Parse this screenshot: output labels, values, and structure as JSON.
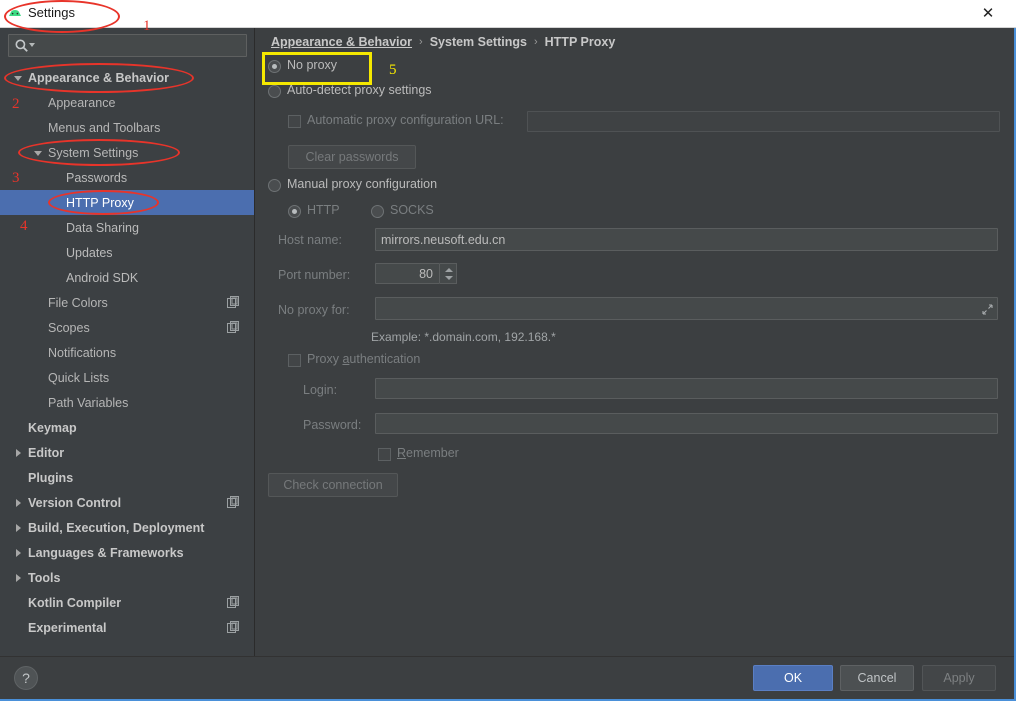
{
  "window": {
    "title": "Settings",
    "icon": "android-studio-icon",
    "close_label": "✕"
  },
  "sidebar": {
    "search": {
      "value": "",
      "placeholder": "",
      "icon": "search-icon"
    },
    "items": [
      {
        "label": "Appearance & Behavior",
        "level": 0,
        "arrow": "down",
        "selected": false,
        "copy_icon": false
      },
      {
        "label": "Appearance",
        "level": 1,
        "arrow": "none",
        "selected": false,
        "copy_icon": false
      },
      {
        "label": "Menus and Toolbars",
        "level": 1,
        "arrow": "none",
        "selected": false,
        "copy_icon": false
      },
      {
        "label": "System Settings",
        "level": 1,
        "arrow": "down",
        "selected": false,
        "copy_icon": false
      },
      {
        "label": "Passwords",
        "level": 2,
        "arrow": "none",
        "selected": false,
        "copy_icon": false
      },
      {
        "label": "HTTP Proxy",
        "level": 2,
        "arrow": "none",
        "selected": true,
        "copy_icon": false
      },
      {
        "label": "Data Sharing",
        "level": 2,
        "arrow": "none",
        "selected": false,
        "copy_icon": false
      },
      {
        "label": "Updates",
        "level": 2,
        "arrow": "none",
        "selected": false,
        "copy_icon": false
      },
      {
        "label": "Android SDK",
        "level": 2,
        "arrow": "none",
        "selected": false,
        "copy_icon": false
      },
      {
        "label": "File Colors",
        "level": 1,
        "arrow": "none",
        "selected": false,
        "copy_icon": true
      },
      {
        "label": "Scopes",
        "level": 1,
        "arrow": "none",
        "selected": false,
        "copy_icon": true
      },
      {
        "label": "Notifications",
        "level": 1,
        "arrow": "none",
        "selected": false,
        "copy_icon": false
      },
      {
        "label": "Quick Lists",
        "level": 1,
        "arrow": "none",
        "selected": false,
        "copy_icon": false
      },
      {
        "label": "Path Variables",
        "level": 1,
        "arrow": "none",
        "selected": false,
        "copy_icon": false
      },
      {
        "label": "Keymap",
        "level": 0,
        "arrow": "none",
        "selected": false,
        "copy_icon": false
      },
      {
        "label": "Editor",
        "level": 0,
        "arrow": "right",
        "selected": false,
        "copy_icon": false
      },
      {
        "label": "Plugins",
        "level": 0,
        "arrow": "none",
        "selected": false,
        "copy_icon": false
      },
      {
        "label": "Version Control",
        "level": 0,
        "arrow": "right",
        "selected": false,
        "copy_icon": true
      },
      {
        "label": "Build, Execution, Deployment",
        "level": 0,
        "arrow": "right",
        "selected": false,
        "copy_icon": false
      },
      {
        "label": "Languages & Frameworks",
        "level": 0,
        "arrow": "right",
        "selected": false,
        "copy_icon": false
      },
      {
        "label": "Tools",
        "level": 0,
        "arrow": "right",
        "selected": false,
        "copy_icon": false
      },
      {
        "label": "Kotlin Compiler",
        "level": 0,
        "arrow": "none",
        "selected": false,
        "copy_icon": true
      },
      {
        "label": "Experimental",
        "level": 0,
        "arrow": "none",
        "selected": false,
        "copy_icon": true
      }
    ]
  },
  "breadcrumb": {
    "part1": "Appearance & Behavior",
    "sep1": "›",
    "part2": "System Settings",
    "sep2": "›",
    "part3": "HTTP Proxy"
  },
  "proxy": {
    "no_proxy": {
      "label": "No proxy",
      "checked": true
    },
    "auto_detect": {
      "label": "Auto-detect proxy settings",
      "checked": false
    },
    "auto_config_url": {
      "label": "Automatic proxy configuration URL:",
      "checked": false,
      "value": "",
      "enabled": false
    },
    "clear_passwords": {
      "label": "Clear passwords",
      "enabled": false
    },
    "manual": {
      "label": "Manual proxy configuration",
      "checked": false
    },
    "http": {
      "label": "HTTP",
      "checked": true
    },
    "socks": {
      "label": "SOCKS",
      "checked": false
    },
    "host_name": {
      "label": "Host name:",
      "value": "mirrors.neusoft.edu.cn"
    },
    "port_number": {
      "label": "Port number:",
      "value": "80"
    },
    "no_proxy_for": {
      "label": "No proxy for:",
      "value": "",
      "expand_icon": "expand-icon"
    },
    "example_hint": "Example: *.domain.com, 192.168.*",
    "proxy_auth": {
      "label_pre": "Proxy ",
      "mnemonic": "a",
      "label_post": "uthentication",
      "checked": false
    },
    "login": {
      "label": "Login:",
      "value": ""
    },
    "password": {
      "label": "Password:",
      "value": ""
    },
    "remember": {
      "mnemonic": "R",
      "label_post": "emember",
      "checked": false
    },
    "check_connection": {
      "label": "Check connection",
      "enabled": false
    }
  },
  "footer": {
    "help": "?",
    "ok": "OK",
    "cancel": "Cancel",
    "apply": "Apply"
  },
  "annotations": {
    "numbers": [
      {
        "text": "1",
        "color": "#e8342a"
      },
      {
        "text": "2",
        "color": "#e8342a"
      },
      {
        "text": "3",
        "color": "#e8342a"
      },
      {
        "text": "4",
        "color": "#e8342a"
      },
      {
        "text": "5",
        "color": "#f5e800"
      }
    ]
  },
  "colors": {
    "accent_selection": "#4b6eaf",
    "panel_bg": "#3c3f41",
    "sidebar_bg": "#3c4043",
    "annotation_red": "#e8342a",
    "annotation_yellow": "#f5e800",
    "window_edge": "#4a90d9"
  }
}
